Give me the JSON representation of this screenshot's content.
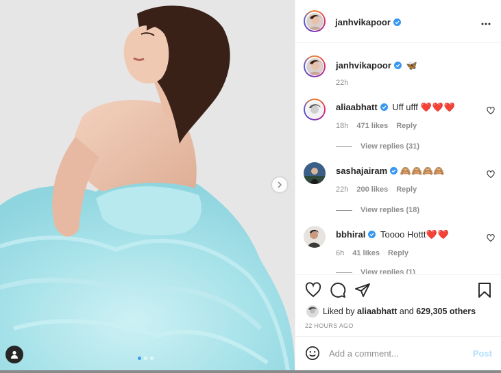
{
  "post": {
    "username": "janhvikapoor",
    "carousel": {
      "slide_count": 3,
      "current_slide": 1
    }
  },
  "caption": {
    "username": "janhvikapoor",
    "text": "🦋",
    "time": "22h"
  },
  "comments": [
    {
      "username": "aliaabhatt",
      "text": "Uff ufff",
      "emoji": "❤️❤️❤️",
      "time": "18h",
      "likes": "471 likes",
      "reply_label": "Reply",
      "view_replies": "View replies (31)"
    },
    {
      "username": "sashajairam",
      "text": "",
      "emoji": "🙈🙈🙈🙈",
      "time": "22h",
      "likes": "200 likes",
      "reply_label": "Reply",
      "view_replies": "View replies (18)"
    },
    {
      "username": "bbhiral",
      "text": "Toooo Hottt",
      "emoji": "❤️❤️",
      "time": "6h",
      "likes": "41 likes",
      "reply_label": "Reply",
      "view_replies": "View replies (1)"
    }
  ],
  "likes": {
    "prefix": "Liked by",
    "user": "aliaabhatt",
    "conjunction": "and",
    "others": "629,305 others"
  },
  "timestamp": "22 HOURS AGO",
  "add_comment": {
    "placeholder": "Add a comment...",
    "post_label": "Post"
  },
  "icons": {
    "header_more": "more-horizontal-icon",
    "next": "chevron-right-icon",
    "tag": "user-tag-icon",
    "like": "heart-outline-icon",
    "comment": "comment-bubble-icon",
    "share": "paper-plane-icon",
    "save": "bookmark-icon",
    "emoji": "smiley-icon",
    "verified": "verified-badge-icon"
  },
  "colors": {
    "verified": "#3897f0",
    "heart": "#e0245e",
    "post_disabled": "#b2dffc",
    "meta": "#8e8e8e"
  }
}
